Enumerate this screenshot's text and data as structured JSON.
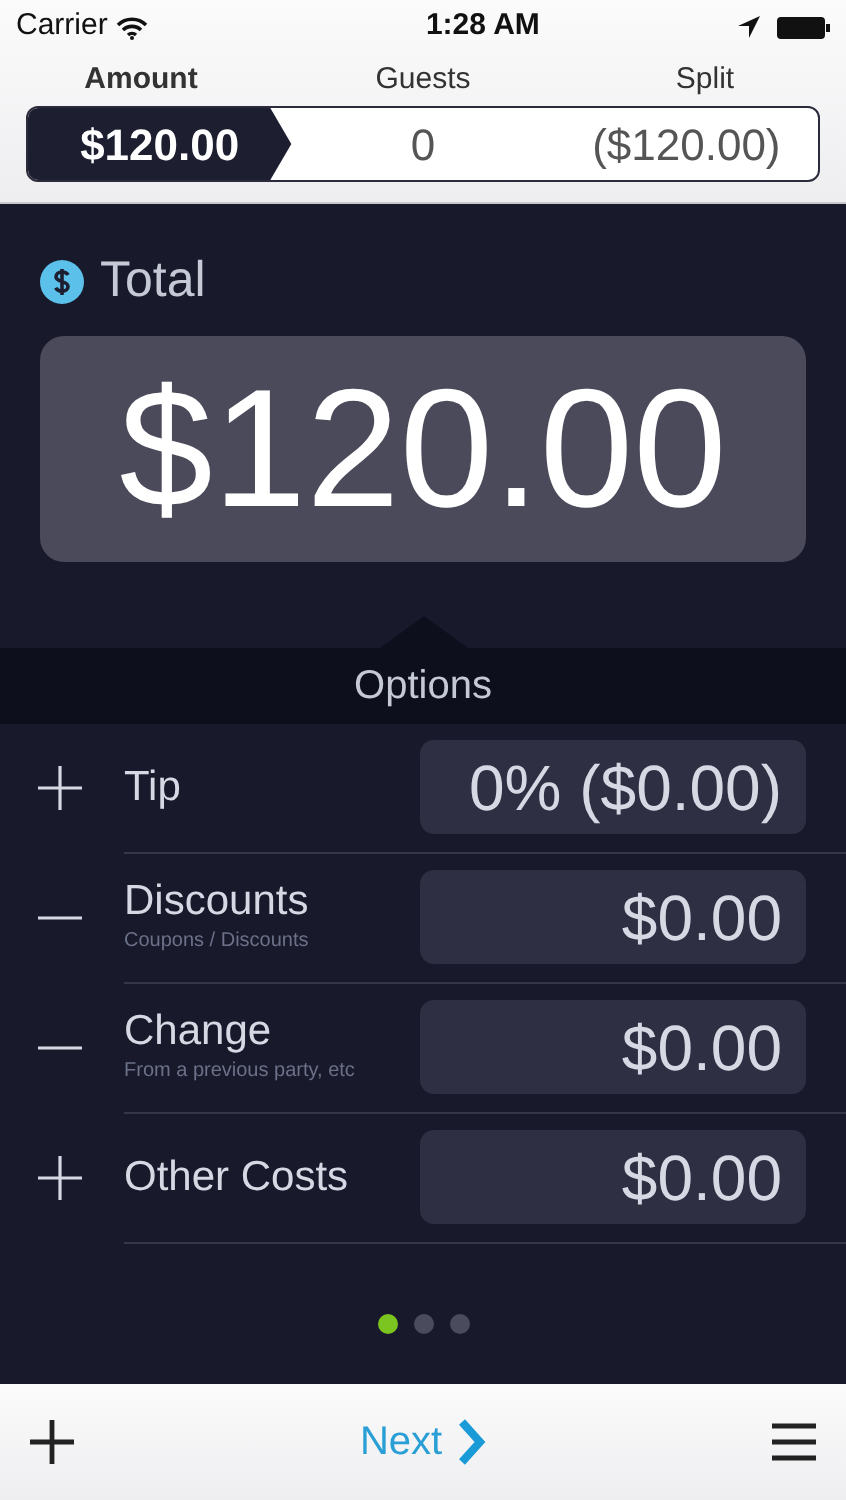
{
  "status_bar": {
    "carrier": "Carrier",
    "time": "1:28 AM"
  },
  "tabs": [
    {
      "label": "Amount",
      "value": "$120.00",
      "selected": true
    },
    {
      "label": "Guests",
      "value": "0",
      "selected": false
    },
    {
      "label": "Split",
      "value": "($120.00)",
      "selected": false
    }
  ],
  "total": {
    "label": "Total",
    "value": "$120.00"
  },
  "options_title": "Options",
  "options": [
    {
      "kind": "add",
      "label": "Tip",
      "value": "0% ($0.00)"
    },
    {
      "kind": "subtract",
      "label": "Discounts",
      "sublabel": "Coupons / Discounts",
      "value": "$0.00"
    },
    {
      "kind": "subtract",
      "label": "Change",
      "sublabel": "From a previous party, etc",
      "value": "$0.00"
    },
    {
      "kind": "add",
      "label": "Other Costs",
      "value": "$0.00"
    }
  ],
  "pages": [
    {
      "selected": true
    },
    {
      "selected": false
    },
    {
      "selected": false
    }
  ],
  "toolbar": {
    "next": "Next"
  }
}
